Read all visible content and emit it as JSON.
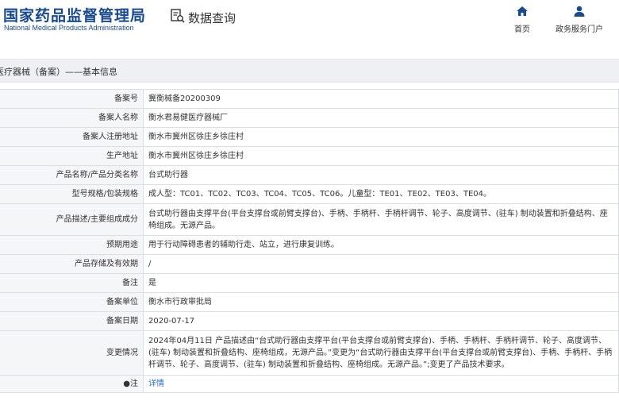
{
  "header": {
    "logo_cn": "国家药品监督管理局",
    "logo_en": "National Medical Products Administration",
    "query_label": "数据查询",
    "nav": [
      {
        "label": "首页",
        "icon": "home-icon"
      },
      {
        "label": "政务服务门户",
        "icon": "user-icon"
      }
    ]
  },
  "breadcrumb": {
    "title": "医疗器械（备案）——基本信息"
  },
  "rows": [
    {
      "label": "备案号",
      "value": "冀衡械备20200309"
    },
    {
      "label": "备案人名称",
      "value": "衡水君易健医疗器械厂"
    },
    {
      "label": "备案人注册地址",
      "value": "衡水市冀州区徐庄乡徐庄村"
    },
    {
      "label": "生产地址",
      "value": "衡水市冀州区徐庄乡徐庄村"
    },
    {
      "label": "产品名称/产品分类名称",
      "value": "台式助行器"
    },
    {
      "label": "型号规格/包装规格",
      "value": "成人型：TC01、TC02、TC03、TC04、TC05、TC06。儿童型：TE01、TE02、TE03、TE04。"
    },
    {
      "label": "产品描述/主要组成成分",
      "value": "台式助行器由支撑平台(平台支撑台或前臂支撑台)、手柄、手柄杆、手柄杆调节、轮子、高度调节、(驻车) 制动装置和折叠结构、座椅组成。无源产品。"
    },
    {
      "label": "预期用途",
      "value": "用于行动障碍患者的辅助行走、站立，进行康复训练。"
    },
    {
      "label": "产品存储及有效期",
      "value": "/"
    },
    {
      "label": "备注",
      "value": "是"
    },
    {
      "label": "备案单位",
      "value": "衡水市行政审批局"
    },
    {
      "label": "备案日期",
      "value": "2020-07-17"
    },
    {
      "label": "变更情况",
      "value": "2024年04月11日 产品描述由“台式助行器由支撑平台(平台支撑台或前臂支撑台)、手柄、手柄杆、手柄杆调节、轮子、高度调节、(驻车) 制动装置和折叠结构、座椅组成，无源产品。”变更为“台式助行器由支撑平台(平台支撑台或前臂支撑台)、手柄、手柄杆、手柄杆调节、轮子、高度调节、(驻车) 制动装置和折叠结构、座椅组成。无源产品。”;变更了产品技术要求。"
    }
  ],
  "note_row": {
    "label": "●注",
    "link": "详情"
  },
  "colors": {
    "brand": "#1a4a8c",
    "link": "#2b6cc4",
    "bar": "#eef0f3"
  }
}
